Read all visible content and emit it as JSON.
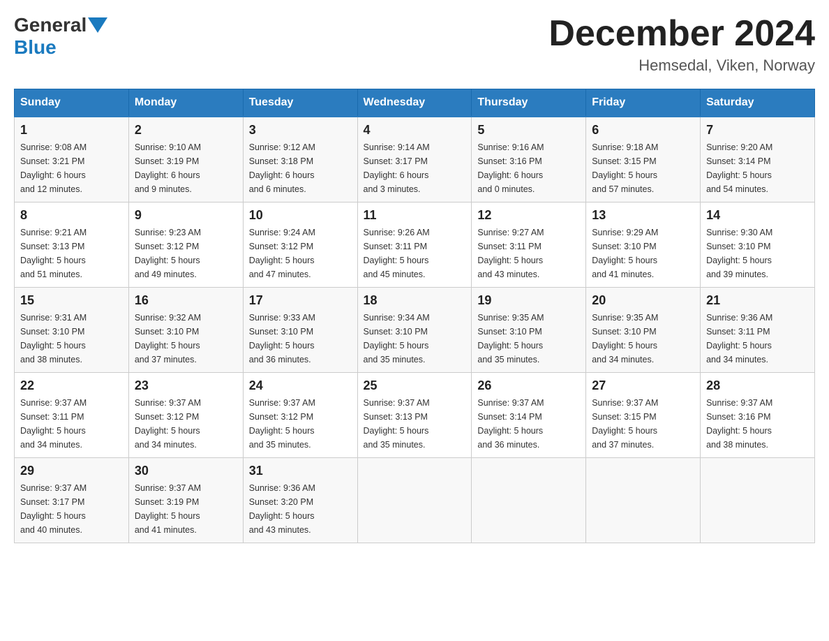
{
  "header": {
    "logo_general": "General",
    "logo_blue": "Blue",
    "month_title": "December 2024",
    "subtitle": "Hemsedal, Viken, Norway"
  },
  "weekdays": [
    "Sunday",
    "Monday",
    "Tuesday",
    "Wednesday",
    "Thursday",
    "Friday",
    "Saturday"
  ],
  "weeks": [
    [
      {
        "day": "1",
        "sunrise": "9:08 AM",
        "sunset": "3:21 PM",
        "daylight": "6 hours and 12 minutes."
      },
      {
        "day": "2",
        "sunrise": "9:10 AM",
        "sunset": "3:19 PM",
        "daylight": "6 hours and 9 minutes."
      },
      {
        "day": "3",
        "sunrise": "9:12 AM",
        "sunset": "3:18 PM",
        "daylight": "6 hours and 6 minutes."
      },
      {
        "day": "4",
        "sunrise": "9:14 AM",
        "sunset": "3:17 PM",
        "daylight": "6 hours and 3 minutes."
      },
      {
        "day": "5",
        "sunrise": "9:16 AM",
        "sunset": "3:16 PM",
        "daylight": "6 hours and 0 minutes."
      },
      {
        "day": "6",
        "sunrise": "9:18 AM",
        "sunset": "3:15 PM",
        "daylight": "5 hours and 57 minutes."
      },
      {
        "day": "7",
        "sunrise": "9:20 AM",
        "sunset": "3:14 PM",
        "daylight": "5 hours and 54 minutes."
      }
    ],
    [
      {
        "day": "8",
        "sunrise": "9:21 AM",
        "sunset": "3:13 PM",
        "daylight": "5 hours and 51 minutes."
      },
      {
        "day": "9",
        "sunrise": "9:23 AM",
        "sunset": "3:12 PM",
        "daylight": "5 hours and 49 minutes."
      },
      {
        "day": "10",
        "sunrise": "9:24 AM",
        "sunset": "3:12 PM",
        "daylight": "5 hours and 47 minutes."
      },
      {
        "day": "11",
        "sunrise": "9:26 AM",
        "sunset": "3:11 PM",
        "daylight": "5 hours and 45 minutes."
      },
      {
        "day": "12",
        "sunrise": "9:27 AM",
        "sunset": "3:11 PM",
        "daylight": "5 hours and 43 minutes."
      },
      {
        "day": "13",
        "sunrise": "9:29 AM",
        "sunset": "3:10 PM",
        "daylight": "5 hours and 41 minutes."
      },
      {
        "day": "14",
        "sunrise": "9:30 AM",
        "sunset": "3:10 PM",
        "daylight": "5 hours and 39 minutes."
      }
    ],
    [
      {
        "day": "15",
        "sunrise": "9:31 AM",
        "sunset": "3:10 PM",
        "daylight": "5 hours and 38 minutes."
      },
      {
        "day": "16",
        "sunrise": "9:32 AM",
        "sunset": "3:10 PM",
        "daylight": "5 hours and 37 minutes."
      },
      {
        "day": "17",
        "sunrise": "9:33 AM",
        "sunset": "3:10 PM",
        "daylight": "5 hours and 36 minutes."
      },
      {
        "day": "18",
        "sunrise": "9:34 AM",
        "sunset": "3:10 PM",
        "daylight": "5 hours and 35 minutes."
      },
      {
        "day": "19",
        "sunrise": "9:35 AM",
        "sunset": "3:10 PM",
        "daylight": "5 hours and 35 minutes."
      },
      {
        "day": "20",
        "sunrise": "9:35 AM",
        "sunset": "3:10 PM",
        "daylight": "5 hours and 34 minutes."
      },
      {
        "day": "21",
        "sunrise": "9:36 AM",
        "sunset": "3:11 PM",
        "daylight": "5 hours and 34 minutes."
      }
    ],
    [
      {
        "day": "22",
        "sunrise": "9:37 AM",
        "sunset": "3:11 PM",
        "daylight": "5 hours and 34 minutes."
      },
      {
        "day": "23",
        "sunrise": "9:37 AM",
        "sunset": "3:12 PM",
        "daylight": "5 hours and 34 minutes."
      },
      {
        "day": "24",
        "sunrise": "9:37 AM",
        "sunset": "3:12 PM",
        "daylight": "5 hours and 35 minutes."
      },
      {
        "day": "25",
        "sunrise": "9:37 AM",
        "sunset": "3:13 PM",
        "daylight": "5 hours and 35 minutes."
      },
      {
        "day": "26",
        "sunrise": "9:37 AM",
        "sunset": "3:14 PM",
        "daylight": "5 hours and 36 minutes."
      },
      {
        "day": "27",
        "sunrise": "9:37 AM",
        "sunset": "3:15 PM",
        "daylight": "5 hours and 37 minutes."
      },
      {
        "day": "28",
        "sunrise": "9:37 AM",
        "sunset": "3:16 PM",
        "daylight": "5 hours and 38 minutes."
      }
    ],
    [
      {
        "day": "29",
        "sunrise": "9:37 AM",
        "sunset": "3:17 PM",
        "daylight": "5 hours and 40 minutes."
      },
      {
        "day": "30",
        "sunrise": "9:37 AM",
        "sunset": "3:19 PM",
        "daylight": "5 hours and 41 minutes."
      },
      {
        "day": "31",
        "sunrise": "9:36 AM",
        "sunset": "3:20 PM",
        "daylight": "5 hours and 43 minutes."
      },
      null,
      null,
      null,
      null
    ]
  ],
  "labels": {
    "sunrise": "Sunrise:",
    "sunset": "Sunset:",
    "daylight": "Daylight:"
  }
}
